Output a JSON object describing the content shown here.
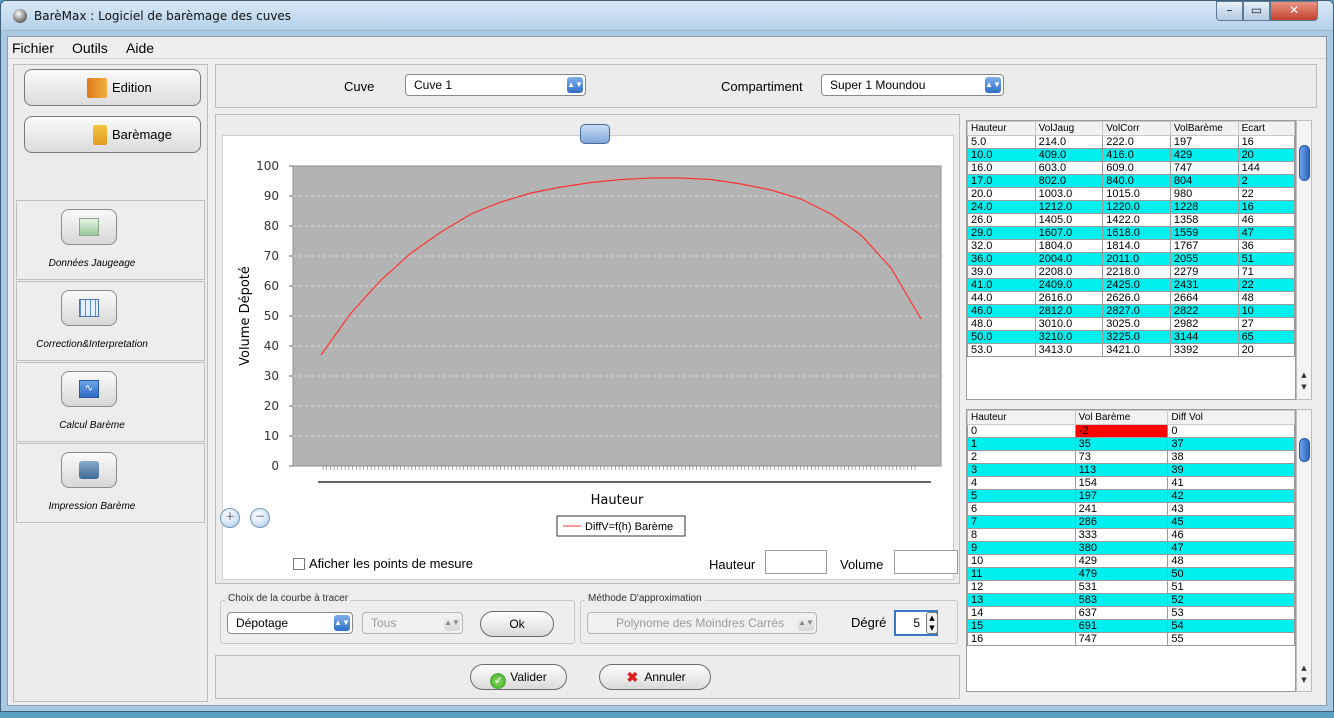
{
  "window": {
    "title": "BarèMax : Logiciel de barèmage des cuves"
  },
  "menu": [
    "Fichier",
    "Outils",
    "Aide"
  ],
  "nav": {
    "edition": "Edition",
    "baremage": "Barèmage"
  },
  "tools": [
    {
      "label": "Données Jaugeage",
      "icon": "picture-icon"
    },
    {
      "label": "Correction&Interpretation",
      "icon": "grid-table-icon"
    },
    {
      "label": "Calcul Barème",
      "icon": "wave-chart-icon"
    },
    {
      "label": "Impression Barème",
      "icon": "printer-icon"
    }
  ],
  "filters": {
    "cuve_label": "Cuve",
    "cuve_value": "Cuve 1",
    "compartiment_label": "Compartiment",
    "compartiment_value": "Super 1 Moundou"
  },
  "chart_options": {
    "show_points_label": "Aficher les points de mesure",
    "hauteur_label": "Hauteur",
    "volume_label": "Volume"
  },
  "curve_choice": {
    "group_label": "Choix de la courbe à tracer",
    "curve_value": "Dépotage",
    "filter_value": "Tous",
    "ok_label": "Ok"
  },
  "approx": {
    "group_label": "Méthode D'approximation",
    "method_value": "Polynome des Moindres Carrés",
    "degree_label": "Dégré",
    "degree_value": "5"
  },
  "actions": {
    "validate": "Valider",
    "cancel": "Annuler"
  },
  "chart_data": {
    "type": "line",
    "title": "",
    "xlabel": "Hauteur",
    "ylabel": "Volume Dépoté",
    "ylim": [
      0,
      100
    ],
    "yticks": [
      0,
      10,
      20,
      30,
      40,
      50,
      60,
      70,
      80,
      90,
      100
    ],
    "grid": true,
    "legend_position": "bottom-center",
    "series": [
      {
        "name": "DiffV=f(h) Barème",
        "color": "#ff3333",
        "x": [
          0,
          0.05,
          0.1,
          0.15,
          0.2,
          0.25,
          0.3,
          0.35,
          0.4,
          0.45,
          0.5,
          0.55,
          0.6,
          0.65,
          0.7,
          0.75,
          0.8,
          0.85,
          0.9,
          0.95,
          1
        ],
        "values": [
          37,
          51,
          62,
          71,
          78,
          84,
          88,
          91,
          93,
          94.5,
          95.5,
          96,
          96,
          95.5,
          94,
          92,
          89,
          84,
          77,
          66,
          49
        ]
      }
    ]
  },
  "table1": {
    "headers": [
      "Hauteur",
      "VolJaug",
      "VolCorr",
      "VolBarème",
      "Ecart"
    ],
    "rows": [
      [
        "5.0",
        "214.0",
        "222.0",
        "197",
        "16"
      ],
      [
        "10.0",
        "409.0",
        "416.0",
        "429",
        "20"
      ],
      [
        "16.0",
        "603.0",
        "609.0",
        "747",
        "144"
      ],
      [
        "17.0",
        "802.0",
        "840.0",
        "804",
        "2"
      ],
      [
        "20.0",
        "1003.0",
        "1015.0",
        "980",
        "22"
      ],
      [
        "24.0",
        "1212.0",
        "1220.0",
        "1228",
        "16"
      ],
      [
        "26.0",
        "1405.0",
        "1422.0",
        "1358",
        "46"
      ],
      [
        "29.0",
        "1607.0",
        "1618.0",
        "1559",
        "47"
      ],
      [
        "32.0",
        "1804.0",
        "1814.0",
        "1767",
        "36"
      ],
      [
        "36.0",
        "2004.0",
        "2011.0",
        "2055",
        "51"
      ],
      [
        "39.0",
        "2208.0",
        "2218.0",
        "2279",
        "71"
      ],
      [
        "41.0",
        "2409.0",
        "2425.0",
        "2431",
        "22"
      ],
      [
        "44.0",
        "2616.0",
        "2626.0",
        "2664",
        "48"
      ],
      [
        "46.0",
        "2812.0",
        "2827.0",
        "2822",
        "10"
      ],
      [
        "48.0",
        "3010.0",
        "3025.0",
        "2982",
        "27"
      ],
      [
        "50.0",
        "3210.0",
        "3225.0",
        "3144",
        "65"
      ],
      [
        "53.0",
        "3413.0",
        "3421.0",
        "3392",
        "20"
      ]
    ]
  },
  "table2": {
    "headers": [
      "Hauteur",
      "Vol Barème",
      "Diff Vol"
    ],
    "rows": [
      [
        "0",
        "-2",
        "0"
      ],
      [
        "1",
        "35",
        "37"
      ],
      [
        "2",
        "73",
        "38"
      ],
      [
        "3",
        "113",
        "39"
      ],
      [
        "4",
        "154",
        "41"
      ],
      [
        "5",
        "197",
        "42"
      ],
      [
        "6",
        "241",
        "43"
      ],
      [
        "7",
        "286",
        "45"
      ],
      [
        "8",
        "333",
        "46"
      ],
      [
        "9",
        "380",
        "47"
      ],
      [
        "10",
        "429",
        "48"
      ],
      [
        "11",
        "479",
        "50"
      ],
      [
        "12",
        "531",
        "51"
      ],
      [
        "13",
        "583",
        "52"
      ],
      [
        "14",
        "637",
        "53"
      ],
      [
        "15",
        "691",
        "54"
      ],
      [
        "16",
        "747",
        "55"
      ]
    ]
  }
}
